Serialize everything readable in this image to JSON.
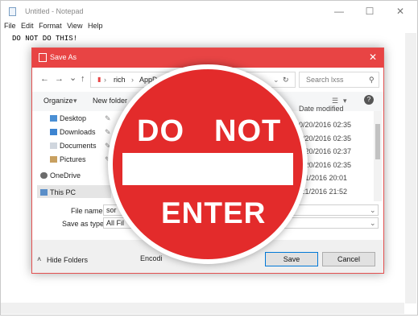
{
  "notepad": {
    "title": "Untitled - Notepad",
    "minimize": "—",
    "maximize": "☐",
    "close": "✕",
    "menu": [
      "File",
      "Edit",
      "Format",
      "View",
      "Help"
    ],
    "text": "DO NOT DO THIS!"
  },
  "dialog": {
    "title": "Save As",
    "close": "✕",
    "nav": {
      "back": "←",
      "forward": "→",
      "dropdown": "⌄",
      "up": "↑",
      "refresh": "↻"
    },
    "address": [
      "rich",
      "AppData"
    ],
    "search_placeholder": "Search lxss",
    "toolbar": {
      "organize": "Organize",
      "new_folder": "New folder"
    },
    "nav_pane": [
      {
        "label": "Desktop"
      },
      {
        "label": "Downloads"
      },
      {
        "label": "Documents"
      },
      {
        "label": "Pictures"
      },
      {
        "label": "OneDrive"
      },
      {
        "label": "This PC"
      }
    ],
    "column_header": "Date modified",
    "dates": [
      "0/20/2016 02:35",
      "0/20/2016 02:35",
      "0/20/2016 02:37",
      "0/20/2016 02:35",
      "/21/2016 20:01",
      "/21/2016 21:52"
    ],
    "file_name_label": "File name:",
    "file_name_value": "sor",
    "save_type_label": "Save as type:",
    "save_type_value": "All Fil",
    "hide_folders": "Hide Folders",
    "encoding_label": "Encodi",
    "save_button": "Save",
    "cancel_button": "Cancel"
  },
  "sign": {
    "line1a": "DO",
    "line1b": "NOT",
    "line2": "ENTER"
  },
  "colors": {
    "dialog_title": "#e84444",
    "sign_red": "#e32b2b",
    "accent_blue": "#0078d7"
  }
}
